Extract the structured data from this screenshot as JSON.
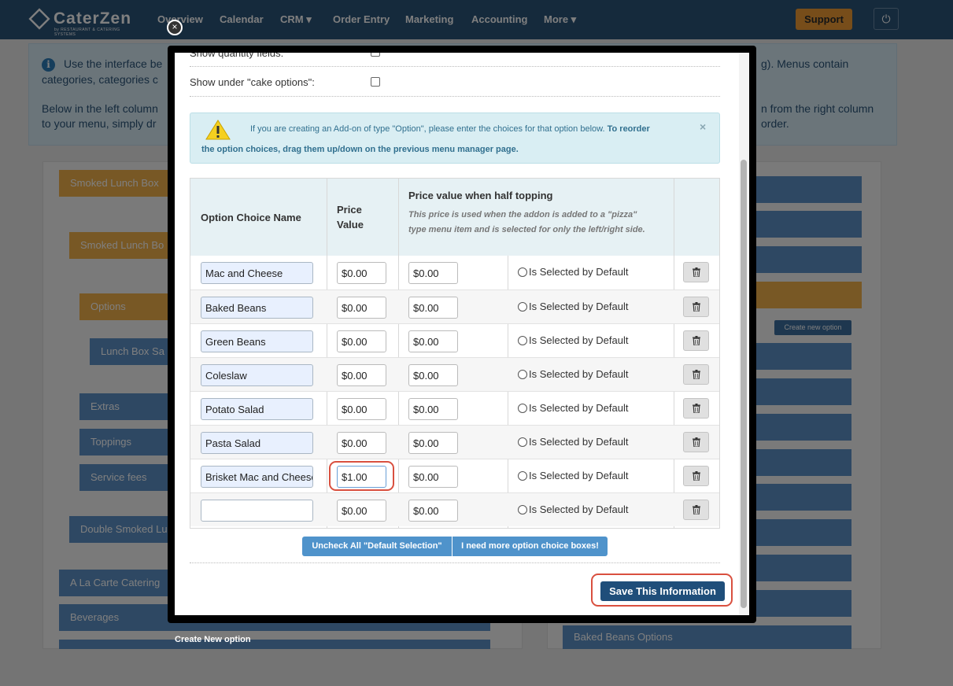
{
  "app": {
    "logo_text": "CaterZen",
    "logo_sub": "by RESTAURANT & CATERING SYSTEMS",
    "nav": [
      "Overview",
      "Calendar",
      "CRM ▾",
      "Order Entry",
      "Marketing",
      "Accounting",
      "More ▾"
    ],
    "support_label": "Support",
    "power_icon": "⏻"
  },
  "background": {
    "info_line1a": "Use the interface be",
    "info_line1b": "g). Menus contain",
    "info_line2": "categories, categories c",
    "info_line3a": "Below in the left column",
    "info_line3b": "n from the right column",
    "info_line4a": "to your menu, simply dr",
    "info_line4b": "order.",
    "left_items": [
      "Smoked Lunch Box",
      "Smoked Lunch Bo",
      "Options",
      "Lunch Box Sa",
      "Extras",
      "Toppings",
      "Service fees",
      "Double Smoked Lu",
      "A La Carte Catering",
      "Beverages"
    ],
    "right_last_item": "Baked Beans Options",
    "create_small": "Create new option",
    "create_new_option": "Create New option"
  },
  "modal": {
    "close_icon": "×",
    "show_quantity_label": "Show quantity fields:",
    "show_cake_label": "Show under \"cake options\":",
    "alert": {
      "text_normal": "If you are creating an Add-on of type \"Option\", please enter the choices for that option below.",
      "text_bold1": "To reorder",
      "text_bold2": "the option choices, drag them up/down on the previous menu manager page.",
      "close": "×"
    },
    "table": {
      "headers": {
        "name": "Option Choice Name",
        "price_line1": "Price",
        "price_line2": "Value",
        "half": "Price value when half topping",
        "half_sub1": "This price is used when the addon is added to a \"pizza\"",
        "half_sub2": "type menu item and is selected for only the left/right side."
      },
      "default_label": "Is Selected by Default",
      "rows": [
        {
          "name": "Mac and Cheese",
          "price": "$0.00",
          "half": "$0.00"
        },
        {
          "name": "Baked Beans",
          "price": "$0.00",
          "half": "$0.00"
        },
        {
          "name": "Green Beans",
          "price": "$0.00",
          "half": "$0.00"
        },
        {
          "name": "Coleslaw",
          "price": "$0.00",
          "half": "$0.00"
        },
        {
          "name": "Potato Salad",
          "price": "$0.00",
          "half": "$0.00"
        },
        {
          "name": "Pasta Salad",
          "price": "$0.00",
          "half": "$0.00"
        },
        {
          "name": "Brisket Mac and Cheese",
          "price": "$1.00",
          "half": "$0.00"
        },
        {
          "name": "",
          "price": "$0.00",
          "half": "$0.00"
        }
      ]
    },
    "uncheck_label": "Uncheck All \"Default Selection\"",
    "more_label": "I need more option choice boxes!",
    "save_label": "Save This Information"
  }
}
